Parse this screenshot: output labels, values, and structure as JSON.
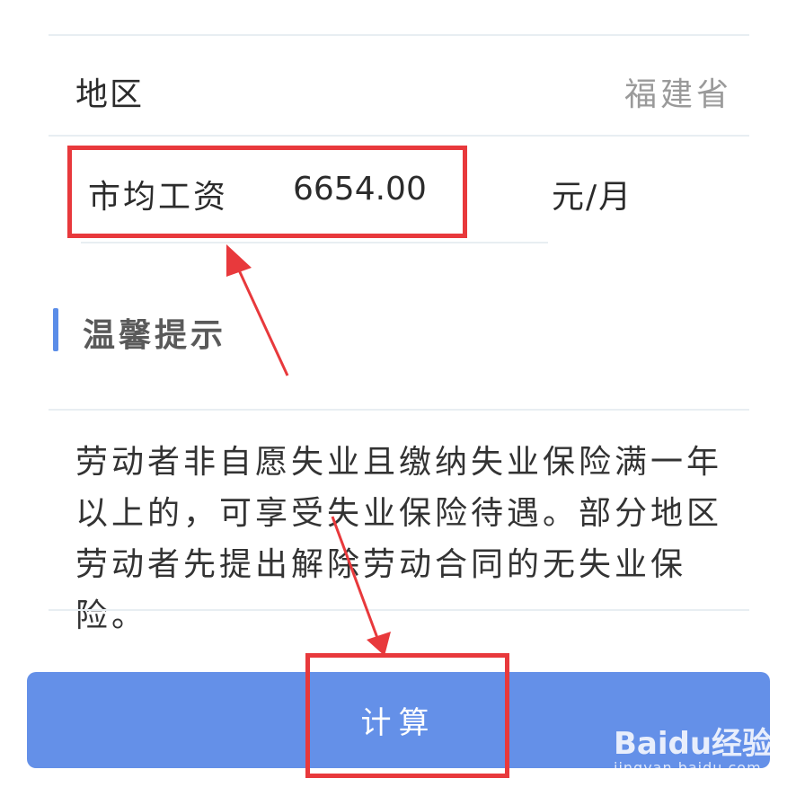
{
  "region": {
    "label": "地区",
    "value": "福建省"
  },
  "salary": {
    "label": "市均工资",
    "value": "6654.00",
    "unit": "元/月"
  },
  "tip": {
    "title": "温馨提示",
    "text": "劳动者非自愿失业且缴纳失业保险满一年以上的，可享受失业保险待遇。部分地区劳动者先提出解除劳动合同的无失业保险。"
  },
  "button": {
    "label": "计算"
  },
  "watermark": {
    "logo": "Baidu经验",
    "url": "jingyan.baidu.com"
  },
  "colors": {
    "accent": "#6490e8",
    "highlight": "#e8393c",
    "divider": "#e8eef2"
  }
}
